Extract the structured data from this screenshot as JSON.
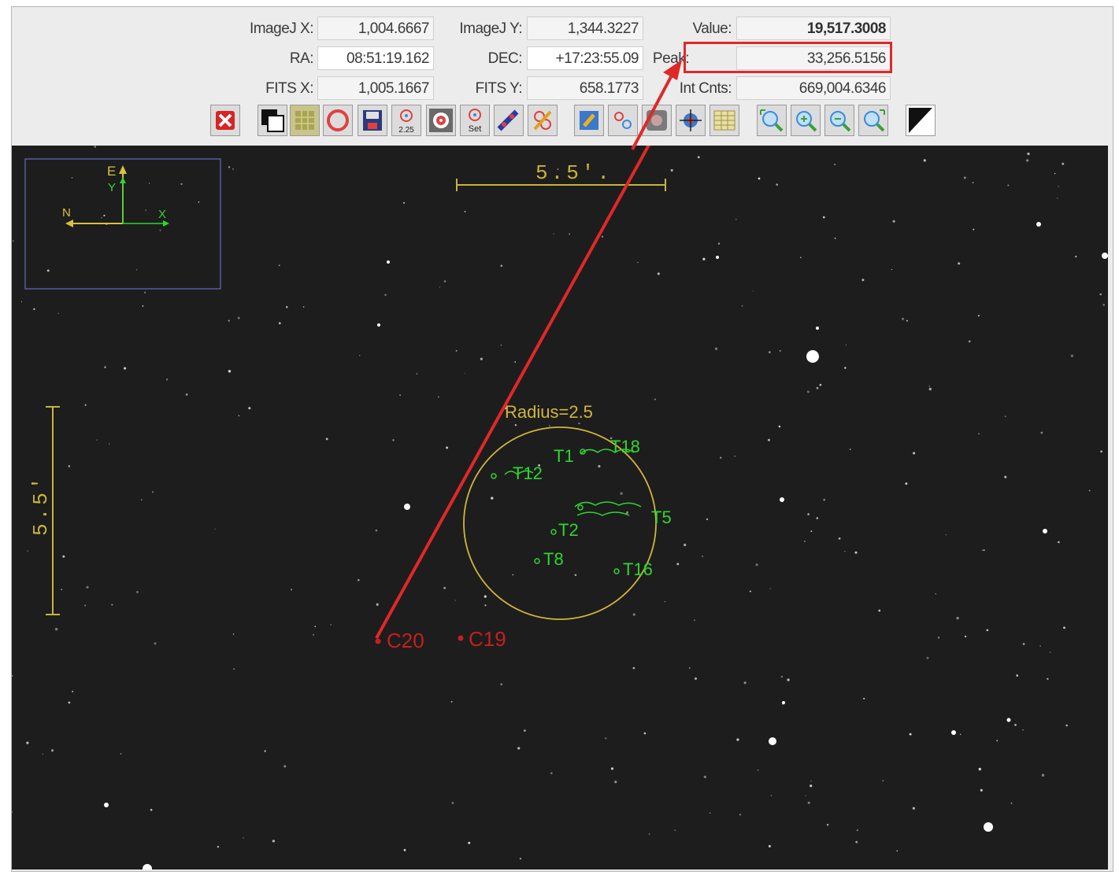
{
  "readout": {
    "imagej_x": {
      "label": "ImageJ X:",
      "value": "1,004.6667"
    },
    "imagej_y": {
      "label": "ImageJ Y:",
      "value": "1,344.3227"
    },
    "value": {
      "label": "Value:",
      "value": "19,517.3008"
    },
    "ra": {
      "label": "RA:",
      "value": "08:51:19.162"
    },
    "dec": {
      "label": "DEC:",
      "value": "+17:23:55.09"
    },
    "peak": {
      "label": "Peak:",
      "value": "33,256.5156"
    },
    "fits_x": {
      "label": "FITS X:",
      "value": "1,005.1667"
    },
    "fits_y": {
      "label": "FITS Y:",
      "value": "658.1773"
    },
    "int_cnts": {
      "label": "Int Cnts:",
      "value": "669,004.6346"
    }
  },
  "toolbar": {
    "aperture_radius_label": "2.25",
    "set_label": "Set"
  },
  "overlay": {
    "scale_top_label": "5.5'.",
    "scale_left_label": "5.5'",
    "compass_e": "E",
    "compass_n": "N",
    "compass_x": "X",
    "compass_y": "Y",
    "radius_label": "Radius=2.5",
    "targets": [
      "T1",
      "T12",
      "T18",
      "T2",
      "T5",
      "T8",
      "T16"
    ],
    "comparisons": [
      "C20",
      "C19"
    ]
  },
  "colors": {
    "highlight": "#e02828",
    "target_green": "#2ed62e",
    "comparison_red": "#c81e1e",
    "scale_yellow": "#c8b43a",
    "compass_box": "#5a5aa0"
  }
}
